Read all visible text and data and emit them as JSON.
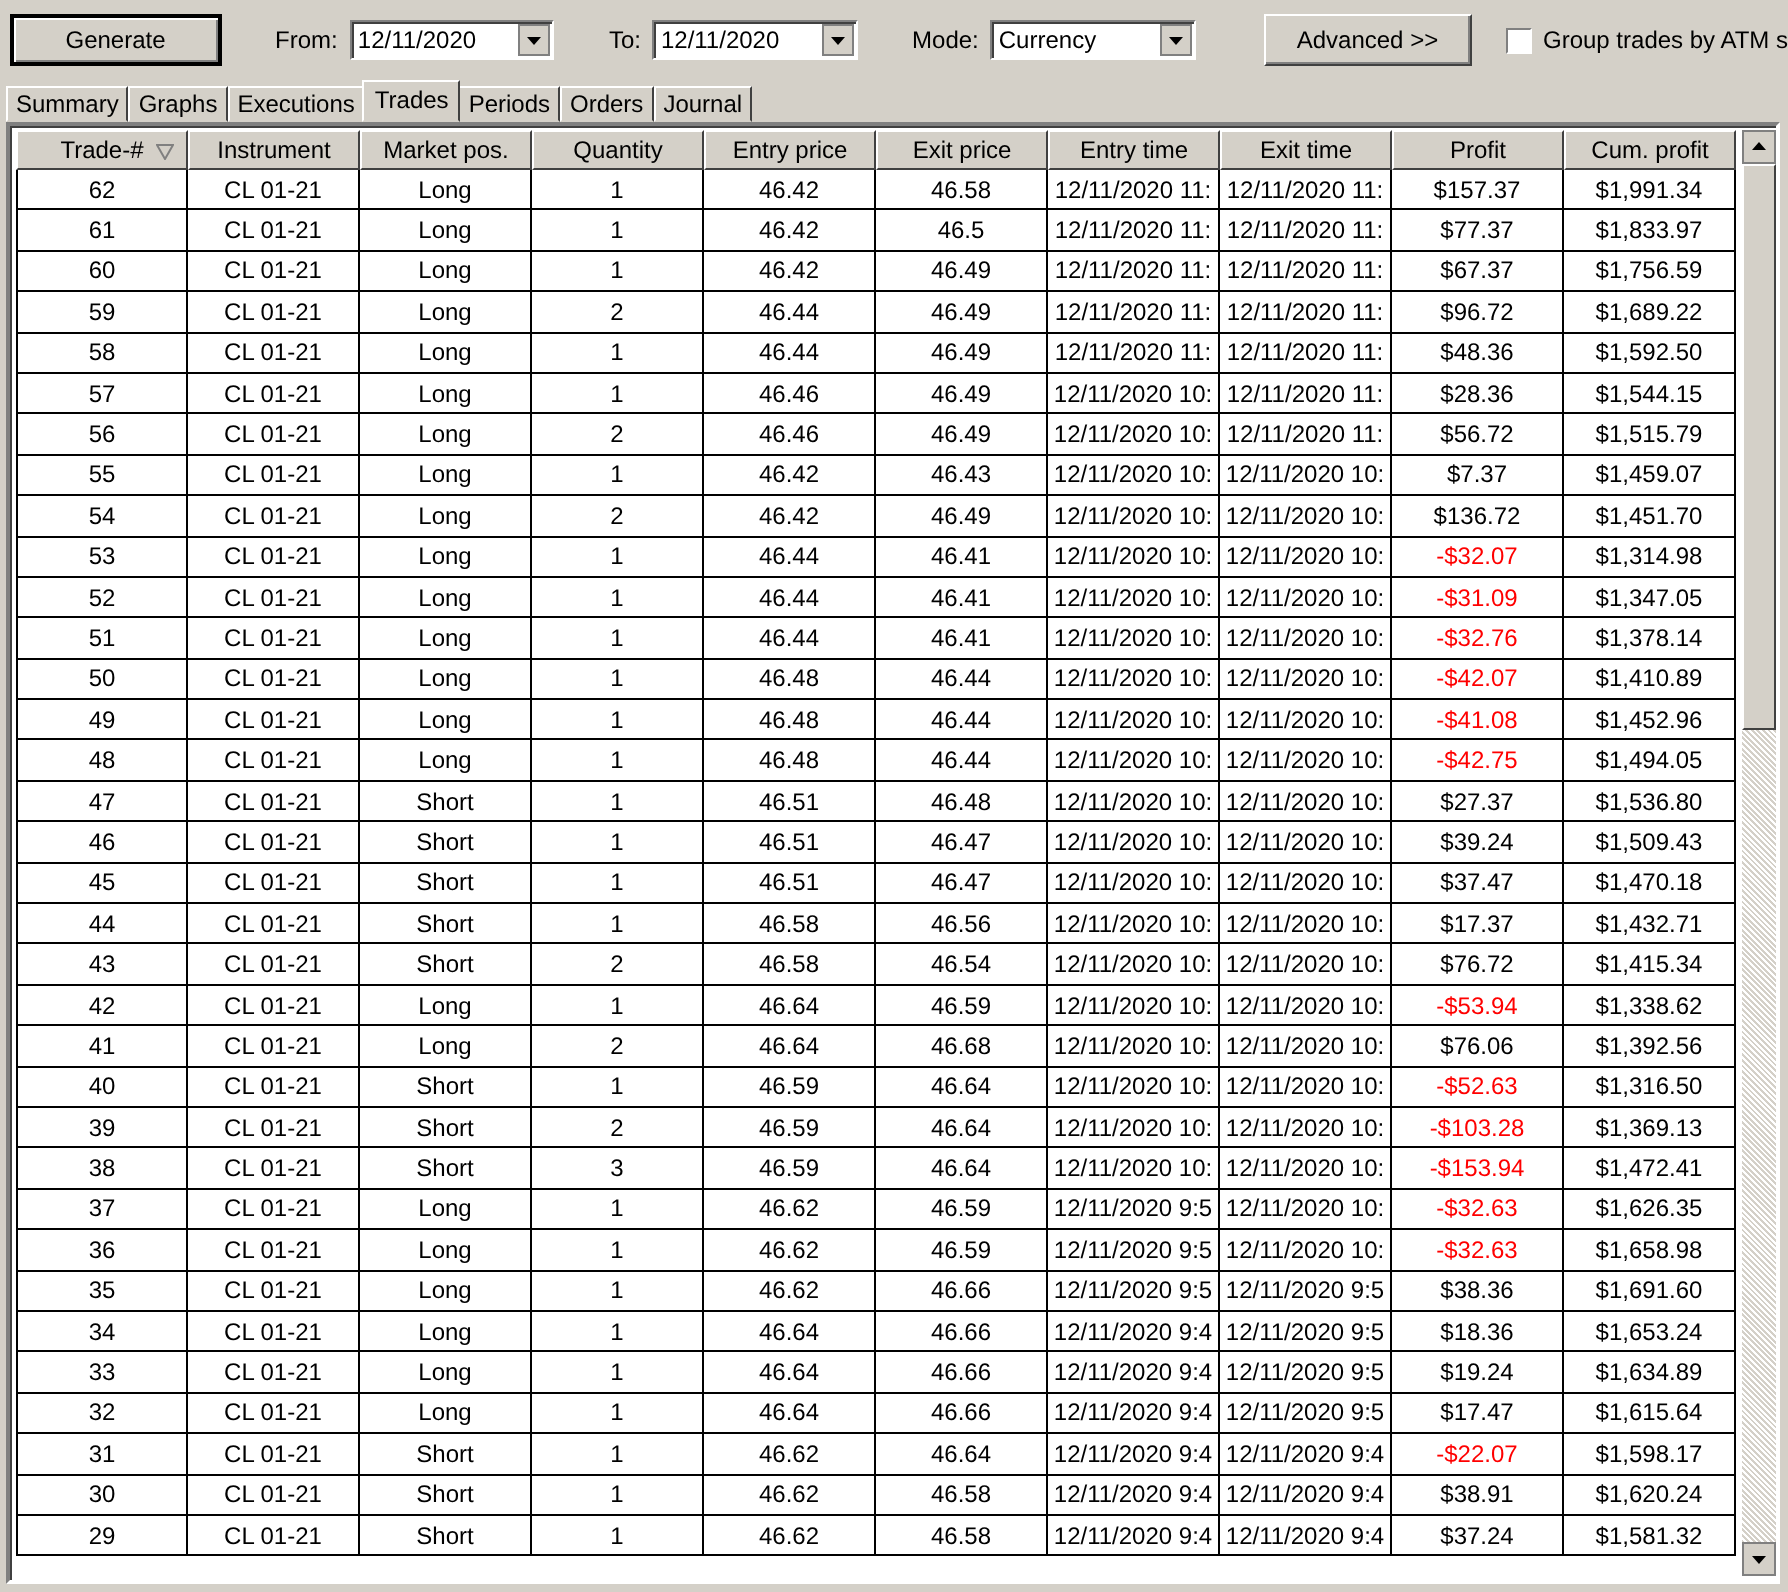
{
  "toolbar": {
    "generate_button": "Generate",
    "from": {
      "label": "From:",
      "value": "12/11/2020"
    },
    "to": {
      "label": "To:",
      "value": "12/11/2020"
    },
    "mode": {
      "label": "Mode:",
      "value": "Currency"
    },
    "advanced_button": "Advanced >>",
    "group_checkbox": {
      "label": "Group trades by ATM s",
      "checked": false
    }
  },
  "tabs": [
    {
      "label": "Summary",
      "selected": false
    },
    {
      "label": "Graphs",
      "selected": false
    },
    {
      "label": "Executions",
      "selected": false
    },
    {
      "label": "Trades",
      "selected": true
    },
    {
      "label": "Periods",
      "selected": false
    },
    {
      "label": "Orders",
      "selected": false
    },
    {
      "label": "Journal",
      "selected": false
    }
  ],
  "table": {
    "columns": [
      {
        "label": "Trade-#",
        "sorted": true
      },
      {
        "label": "Instrument",
        "sorted": false
      },
      {
        "label": "Market pos.",
        "sorted": false
      },
      {
        "label": "Quantity",
        "sorted": false
      },
      {
        "label": "Entry price",
        "sorted": false
      },
      {
        "label": "Exit price",
        "sorted": false
      },
      {
        "label": "Entry time",
        "sorted": false
      },
      {
        "label": "Exit time",
        "sorted": false
      },
      {
        "label": "Profit",
        "sorted": false
      },
      {
        "label": "Cum. profit",
        "sorted": false
      }
    ],
    "rows": [
      {
        "cells": [
          "62",
          "CL 01-21",
          "Long",
          "1",
          "46.42",
          "46.58",
          "12/11/2020 11:",
          "12/11/2020 11:",
          "$157.37",
          "$1,991.34"
        ],
        "loss": false
      },
      {
        "cells": [
          "61",
          "CL 01-21",
          "Long",
          "1",
          "46.42",
          "46.5",
          "12/11/2020 11:",
          "12/11/2020 11:",
          "$77.37",
          "$1,833.97"
        ],
        "loss": false
      },
      {
        "cells": [
          "60",
          "CL 01-21",
          "Long",
          "1",
          "46.42",
          "46.49",
          "12/11/2020 11:",
          "12/11/2020 11:",
          "$67.37",
          "$1,756.59"
        ],
        "loss": false
      },
      {
        "cells": [
          "59",
          "CL 01-21",
          "Long",
          "2",
          "46.44",
          "46.49",
          "12/11/2020 11:",
          "12/11/2020 11:",
          "$96.72",
          "$1,689.22"
        ],
        "loss": false
      },
      {
        "cells": [
          "58",
          "CL 01-21",
          "Long",
          "1",
          "46.44",
          "46.49",
          "12/11/2020 11:",
          "12/11/2020 11:",
          "$48.36",
          "$1,592.50"
        ],
        "loss": false
      },
      {
        "cells": [
          "57",
          "CL 01-21",
          "Long",
          "1",
          "46.46",
          "46.49",
          "12/11/2020 10:",
          "12/11/2020 11:",
          "$28.36",
          "$1,544.15"
        ],
        "loss": false
      },
      {
        "cells": [
          "56",
          "CL 01-21",
          "Long",
          "2",
          "46.46",
          "46.49",
          "12/11/2020 10:",
          "12/11/2020 11:",
          "$56.72",
          "$1,515.79"
        ],
        "loss": false
      },
      {
        "cells": [
          "55",
          "CL 01-21",
          "Long",
          "1",
          "46.42",
          "46.43",
          "12/11/2020 10:",
          "12/11/2020 10:",
          "$7.37",
          "$1,459.07"
        ],
        "loss": false
      },
      {
        "cells": [
          "54",
          "CL 01-21",
          "Long",
          "2",
          "46.42",
          "46.49",
          "12/11/2020 10:",
          "12/11/2020 10:",
          "$136.72",
          "$1,451.70"
        ],
        "loss": false
      },
      {
        "cells": [
          "53",
          "CL 01-21",
          "Long",
          "1",
          "46.44",
          "46.41",
          "12/11/2020 10:",
          "12/11/2020 10:",
          "-$32.07",
          "$1,314.98"
        ],
        "loss": true
      },
      {
        "cells": [
          "52",
          "CL 01-21",
          "Long",
          "1",
          "46.44",
          "46.41",
          "12/11/2020 10:",
          "12/11/2020 10:",
          "-$31.09",
          "$1,347.05"
        ],
        "loss": true
      },
      {
        "cells": [
          "51",
          "CL 01-21",
          "Long",
          "1",
          "46.44",
          "46.41",
          "12/11/2020 10:",
          "12/11/2020 10:",
          "-$32.76",
          "$1,378.14"
        ],
        "loss": true
      },
      {
        "cells": [
          "50",
          "CL 01-21",
          "Long",
          "1",
          "46.48",
          "46.44",
          "12/11/2020 10:",
          "12/11/2020 10:",
          "-$42.07",
          "$1,410.89"
        ],
        "loss": true
      },
      {
        "cells": [
          "49",
          "CL 01-21",
          "Long",
          "1",
          "46.48",
          "46.44",
          "12/11/2020 10:",
          "12/11/2020 10:",
          "-$41.08",
          "$1,452.96"
        ],
        "loss": true
      },
      {
        "cells": [
          "48",
          "CL 01-21",
          "Long",
          "1",
          "46.48",
          "46.44",
          "12/11/2020 10:",
          "12/11/2020 10:",
          "-$42.75",
          "$1,494.05"
        ],
        "loss": true
      },
      {
        "cells": [
          "47",
          "CL 01-21",
          "Short",
          "1",
          "46.51",
          "46.48",
          "12/11/2020 10:",
          "12/11/2020 10:",
          "$27.37",
          "$1,536.80"
        ],
        "loss": false
      },
      {
        "cells": [
          "46",
          "CL 01-21",
          "Short",
          "1",
          "46.51",
          "46.47",
          "12/11/2020 10:",
          "12/11/2020 10:",
          "$39.24",
          "$1,509.43"
        ],
        "loss": false
      },
      {
        "cells": [
          "45",
          "CL 01-21",
          "Short",
          "1",
          "46.51",
          "46.47",
          "12/11/2020 10:",
          "12/11/2020 10:",
          "$37.47",
          "$1,470.18"
        ],
        "loss": false
      },
      {
        "cells": [
          "44",
          "CL 01-21",
          "Short",
          "1",
          "46.58",
          "46.56",
          "12/11/2020 10:",
          "12/11/2020 10:",
          "$17.37",
          "$1,432.71"
        ],
        "loss": false
      },
      {
        "cells": [
          "43",
          "CL 01-21",
          "Short",
          "2",
          "46.58",
          "46.54",
          "12/11/2020 10:",
          "12/11/2020 10:",
          "$76.72",
          "$1,415.34"
        ],
        "loss": false
      },
      {
        "cells": [
          "42",
          "CL 01-21",
          "Long",
          "1",
          "46.64",
          "46.59",
          "12/11/2020 10:",
          "12/11/2020 10:",
          "-$53.94",
          "$1,338.62"
        ],
        "loss": true
      },
      {
        "cells": [
          "41",
          "CL 01-21",
          "Long",
          "2",
          "46.64",
          "46.68",
          "12/11/2020 10:",
          "12/11/2020 10:",
          "$76.06",
          "$1,392.56"
        ],
        "loss": false
      },
      {
        "cells": [
          "40",
          "CL 01-21",
          "Short",
          "1",
          "46.59",
          "46.64",
          "12/11/2020 10:",
          "12/11/2020 10:",
          "-$52.63",
          "$1,316.50"
        ],
        "loss": true
      },
      {
        "cells": [
          "39",
          "CL 01-21",
          "Short",
          "2",
          "46.59",
          "46.64",
          "12/11/2020 10:",
          "12/11/2020 10:",
          "-$103.28",
          "$1,369.13"
        ],
        "loss": true
      },
      {
        "cells": [
          "38",
          "CL 01-21",
          "Short",
          "3",
          "46.59",
          "46.64",
          "12/11/2020 10:",
          "12/11/2020 10:",
          "-$153.94",
          "$1,472.41"
        ],
        "loss": true
      },
      {
        "cells": [
          "37",
          "CL 01-21",
          "Long",
          "1",
          "46.62",
          "46.59",
          "12/11/2020 9:5",
          "12/11/2020 10:",
          "-$32.63",
          "$1,626.35"
        ],
        "loss": true
      },
      {
        "cells": [
          "36",
          "CL 01-21",
          "Long",
          "1",
          "46.62",
          "46.59",
          "12/11/2020 9:5",
          "12/11/2020 10:",
          "-$32.63",
          "$1,658.98"
        ],
        "loss": true
      },
      {
        "cells": [
          "35",
          "CL 01-21",
          "Long",
          "1",
          "46.62",
          "46.66",
          "12/11/2020 9:5",
          "12/11/2020 9:5",
          "$38.36",
          "$1,691.60"
        ],
        "loss": false
      },
      {
        "cells": [
          "34",
          "CL 01-21",
          "Long",
          "1",
          "46.64",
          "46.66",
          "12/11/2020 9:4",
          "12/11/2020 9:5",
          "$18.36",
          "$1,653.24"
        ],
        "loss": false
      },
      {
        "cells": [
          "33",
          "CL 01-21",
          "Long",
          "1",
          "46.64",
          "46.66",
          "12/11/2020 9:4",
          "12/11/2020 9:5",
          "$19.24",
          "$1,634.89"
        ],
        "loss": false
      },
      {
        "cells": [
          "32",
          "CL 01-21",
          "Long",
          "1",
          "46.64",
          "46.66",
          "12/11/2020 9:4",
          "12/11/2020 9:5",
          "$17.47",
          "$1,615.64"
        ],
        "loss": false
      },
      {
        "cells": [
          "31",
          "CL 01-21",
          "Short",
          "1",
          "46.62",
          "46.64",
          "12/11/2020 9:4",
          "12/11/2020 9:4",
          "-$22.07",
          "$1,598.17"
        ],
        "loss": true
      },
      {
        "cells": [
          "30",
          "CL 01-21",
          "Short",
          "1",
          "46.62",
          "46.58",
          "12/11/2020 9:4",
          "12/11/2020 9:4",
          "$38.91",
          "$1,620.24"
        ],
        "loss": false
      },
      {
        "cells": [
          "29",
          "CL 01-21",
          "Short",
          "1",
          "46.62",
          "46.58",
          "12/11/2020 9:4",
          "12/11/2020 9:4",
          "$37.24",
          "$1,581.32"
        ],
        "loss": false
      }
    ]
  }
}
